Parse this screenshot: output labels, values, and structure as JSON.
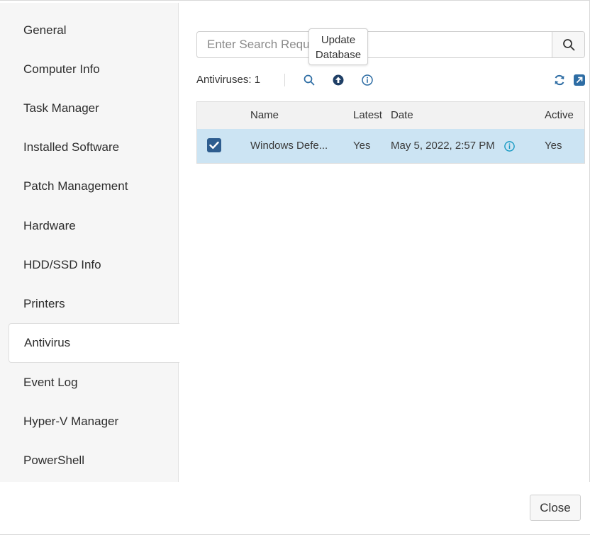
{
  "sidebar": {
    "items": [
      {
        "label": "General"
      },
      {
        "label": "Computer Info"
      },
      {
        "label": "Task Manager"
      },
      {
        "label": "Installed Software"
      },
      {
        "label": "Patch Management"
      },
      {
        "label": "Hardware"
      },
      {
        "label": "HDD/SSD Info"
      },
      {
        "label": "Printers"
      },
      {
        "label": "Antivirus",
        "active": true
      },
      {
        "label": "Event Log"
      },
      {
        "label": "Hyper-V Manager"
      },
      {
        "label": "PowerShell"
      }
    ]
  },
  "search": {
    "placeholder": "Enter Search Request",
    "icon": "search-icon"
  },
  "tooltip": {
    "line1": "Update",
    "line2": "Database"
  },
  "toolbar": {
    "count_label": "Antiviruses: 1",
    "icons": [
      "search-icon",
      "upload-arrow-icon",
      "info-icon",
      "refresh-icon",
      "external-link-icon"
    ],
    "accent_color": "#2e6da4"
  },
  "table": {
    "columns": [
      "Name",
      "Latest",
      "Date",
      "Active"
    ],
    "rows": [
      {
        "checked": true,
        "name": "Windows Defe...",
        "latest": "Yes",
        "date": "May 5, 2022, 2:57 PM",
        "active": "Yes"
      }
    ],
    "selected_row_color": "#cce4f3"
  },
  "footer": {
    "close_label": "Close"
  }
}
